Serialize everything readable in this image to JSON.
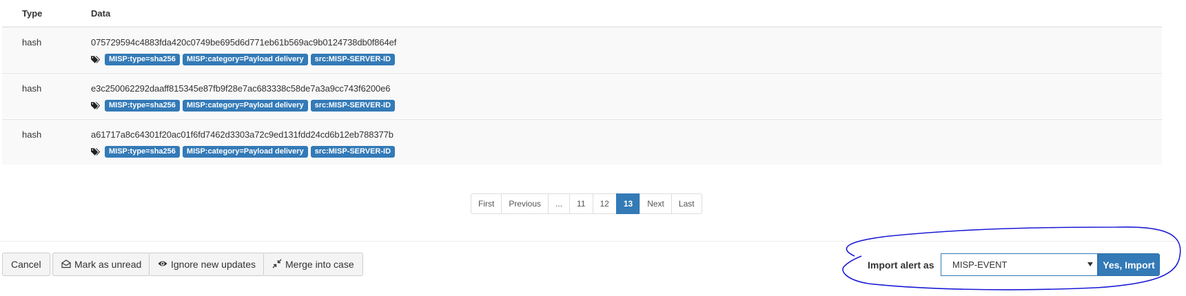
{
  "table": {
    "headers": {
      "type": "Type",
      "data": "Data"
    },
    "rows": [
      {
        "type": "hash",
        "value": "075729594c4883fda420c0749be695d6d771eb61b569ac9b0124738db0f864ef",
        "tags": [
          "MISP:type=sha256",
          "MISP:category=Payload delivery",
          "src:MISP-SERVER-ID"
        ]
      },
      {
        "type": "hash",
        "value": "e3c250062292daaff815345e87fb9f28e7ac683338c58de7a3a9cc743f6200e6",
        "tags": [
          "MISP:type=sha256",
          "MISP:category=Payload delivery",
          "src:MISP-SERVER-ID"
        ]
      },
      {
        "type": "hash",
        "value": "a61717a8c64301f20ac01f6fd7462d3303a72c9ed131fdd24cd6b12eb788377b",
        "tags": [
          "MISP:type=sha256",
          "MISP:category=Payload delivery",
          "src:MISP-SERVER-ID"
        ]
      }
    ]
  },
  "pagination": {
    "items": [
      "First",
      "Previous",
      "...",
      "11",
      "12",
      "13",
      "Next",
      "Last"
    ],
    "active": "13"
  },
  "footer": {
    "cancel": "Cancel",
    "mark_unread": "Mark as unread",
    "ignore_updates": "Ignore new updates",
    "merge_case": "Merge into case",
    "import_label": "Import alert as",
    "import_select": "MISP-EVENT",
    "import_button": "Yes, Import"
  },
  "colors": {
    "primary": "#337ab7",
    "annotation": "#1a1ad6"
  },
  "icons": {
    "tags": "tags-icon",
    "envelope": "envelope-open-icon",
    "eye": "eye-icon",
    "merge": "compress-icon",
    "caret": "caret-down-icon"
  }
}
